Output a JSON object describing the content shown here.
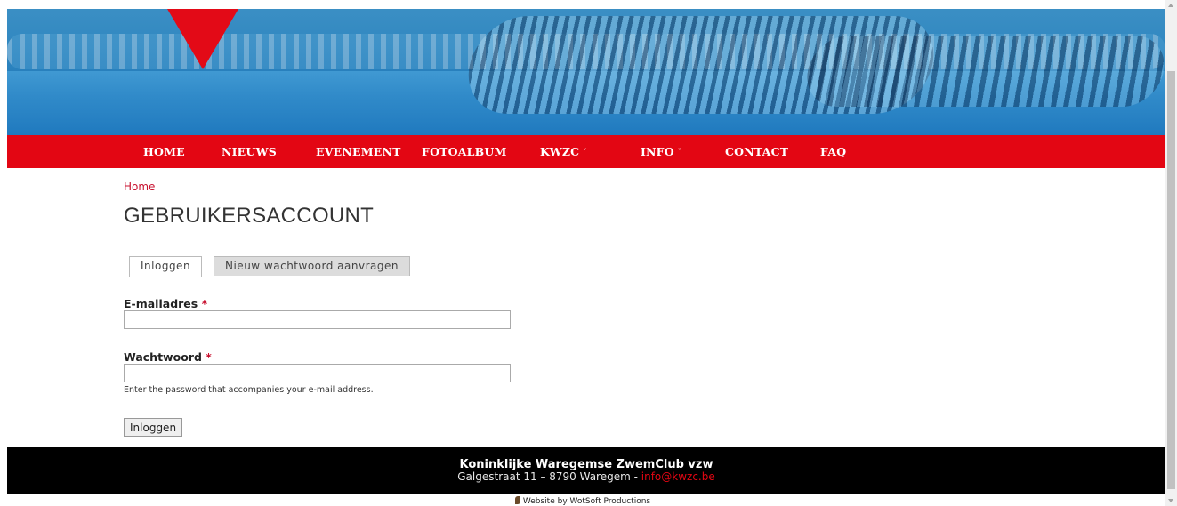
{
  "nav": {
    "items": [
      {
        "label": "HOME"
      },
      {
        "label": "NIEUWS"
      },
      {
        "label": "EVENEMENT"
      },
      {
        "label": "FOTOALBUM"
      },
      {
        "label": "KWZC"
      },
      {
        "label": "INFO"
      },
      {
        "label": "CONTACT"
      },
      {
        "label": "FAQ"
      }
    ],
    "caret": "˅"
  },
  "breadcrumb": {
    "home": "Home"
  },
  "page": {
    "title": "GEBRUIKERSACCOUNT"
  },
  "tabs": [
    {
      "label": "Inloggen",
      "active": true
    },
    {
      "label": "Nieuw wachtwoord aanvragen",
      "active": false
    }
  ],
  "form": {
    "email_label": "E-mailadres",
    "email_value": "",
    "password_label": "Wachtwoord",
    "password_value": "",
    "required_marker": "*",
    "password_help": "Enter the password that accompanies your e-mail address.",
    "submit_label": "Inloggen"
  },
  "footer": {
    "org": "Koninklijke Waregemse ZwemClub vzw",
    "address": "Galgestraat 11 – 8790 Waregem - ",
    "email": "info@kwzc.be",
    "credit": "Website by WotSoft Productions"
  },
  "colors": {
    "accent": "#e30613",
    "footer_bg": "#000000"
  },
  "icons": {
    "logo": "kwzc-logo-triangle-icon",
    "credit": "wotsoft-icon"
  }
}
